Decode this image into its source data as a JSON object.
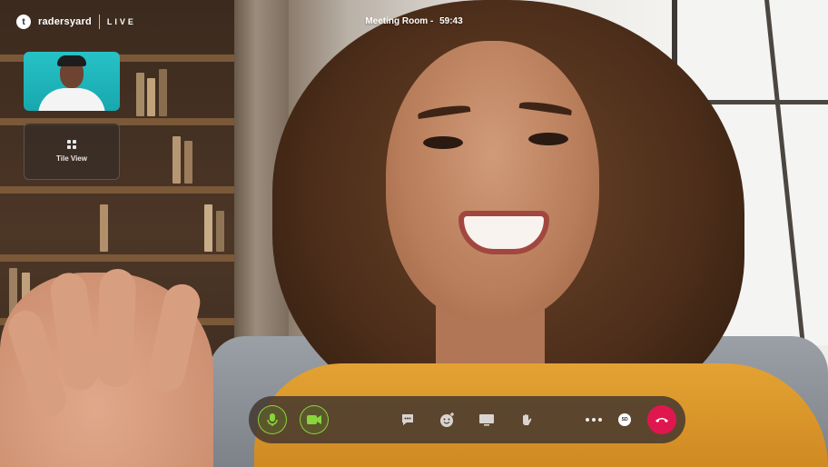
{
  "brand": {
    "mark": "t",
    "name": "radersyard",
    "live": "LIVE"
  },
  "meeting": {
    "title": "Meeting Room -",
    "timer": "59:43"
  },
  "sidebar": {
    "tile_view_label": "Tile View"
  },
  "toolbar": {
    "buttons": [
      {
        "name": "microphone",
        "icon": "mic-icon",
        "state": "on"
      },
      {
        "name": "camera",
        "icon": "video-camera-icon",
        "state": "on"
      },
      {
        "name": "chat",
        "icon": "chat-icon"
      },
      {
        "name": "reactions",
        "icon": "emoji-icon"
      },
      {
        "name": "screen-share",
        "icon": "monitor-icon"
      },
      {
        "name": "raise-hand",
        "icon": "hand-icon"
      },
      {
        "name": "more-options",
        "icon": "more-dots-icon"
      },
      {
        "name": "quality",
        "icon": "sd-badge-icon",
        "label": "SD"
      },
      {
        "name": "end-call",
        "icon": "phone-hangup-icon"
      }
    ],
    "sd_label": "SD"
  },
  "colors": {
    "accent_green": "#8ad43d",
    "end_call": "#e0174e",
    "toolbar_bg": "#46382e"
  }
}
